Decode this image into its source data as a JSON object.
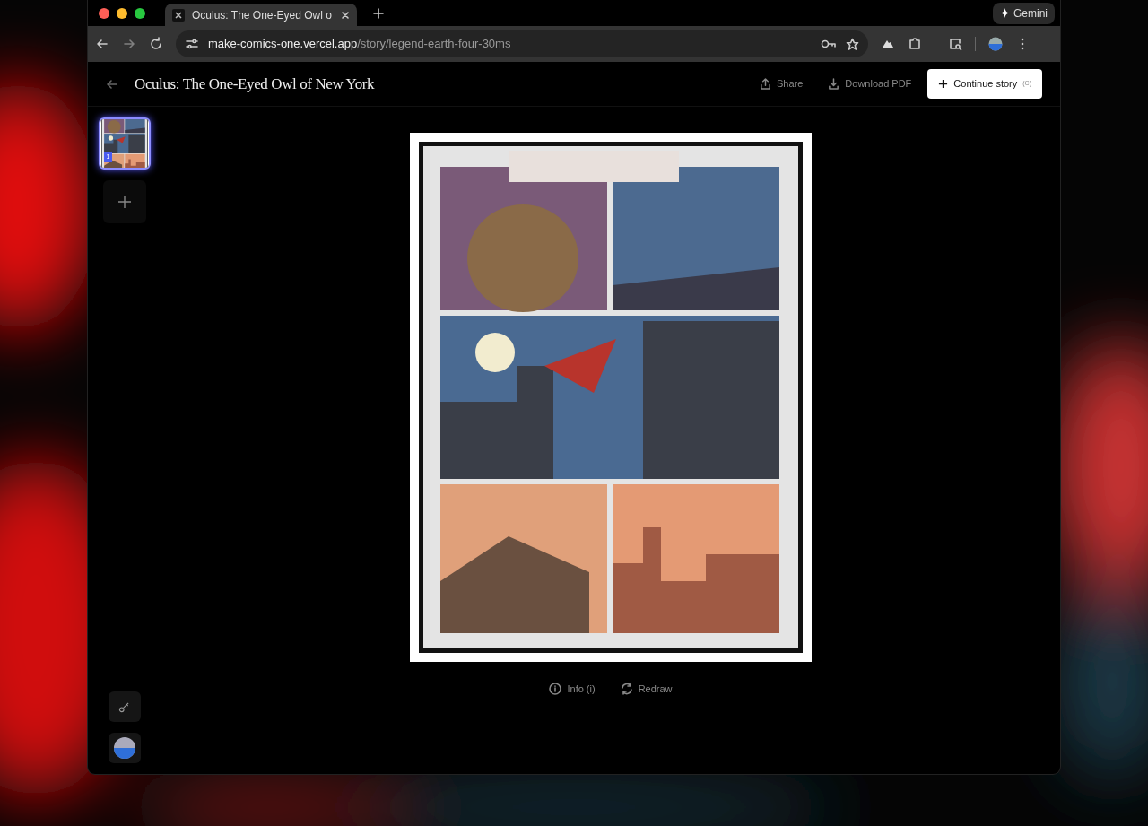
{
  "browser": {
    "tabs": [
      {
        "title": "Oculus: The One-Eyed Owl o",
        "selected": true
      }
    ],
    "gemini_button": "Gemini",
    "url": {
      "host": "make-comics-one.vercel.app",
      "path": "/story/legend-earth-four-30ms"
    }
  },
  "header": {
    "title": "Oculus: The One-Eyed Owl of New York",
    "actions": [
      {
        "label": "Share",
        "kind": "share"
      },
      {
        "label": "Download PDF",
        "kind": "download"
      }
    ],
    "primary": {
      "label": "Continue story",
      "shortcut": "(C)"
    }
  },
  "sidebar": {
    "pages": [
      {
        "number": "1",
        "selected": true
      }
    ]
  },
  "footer_actions": [
    {
      "label": "Info (i)",
      "kind": "info"
    },
    {
      "label": "Redraw",
      "kind": "redraw"
    }
  ]
}
